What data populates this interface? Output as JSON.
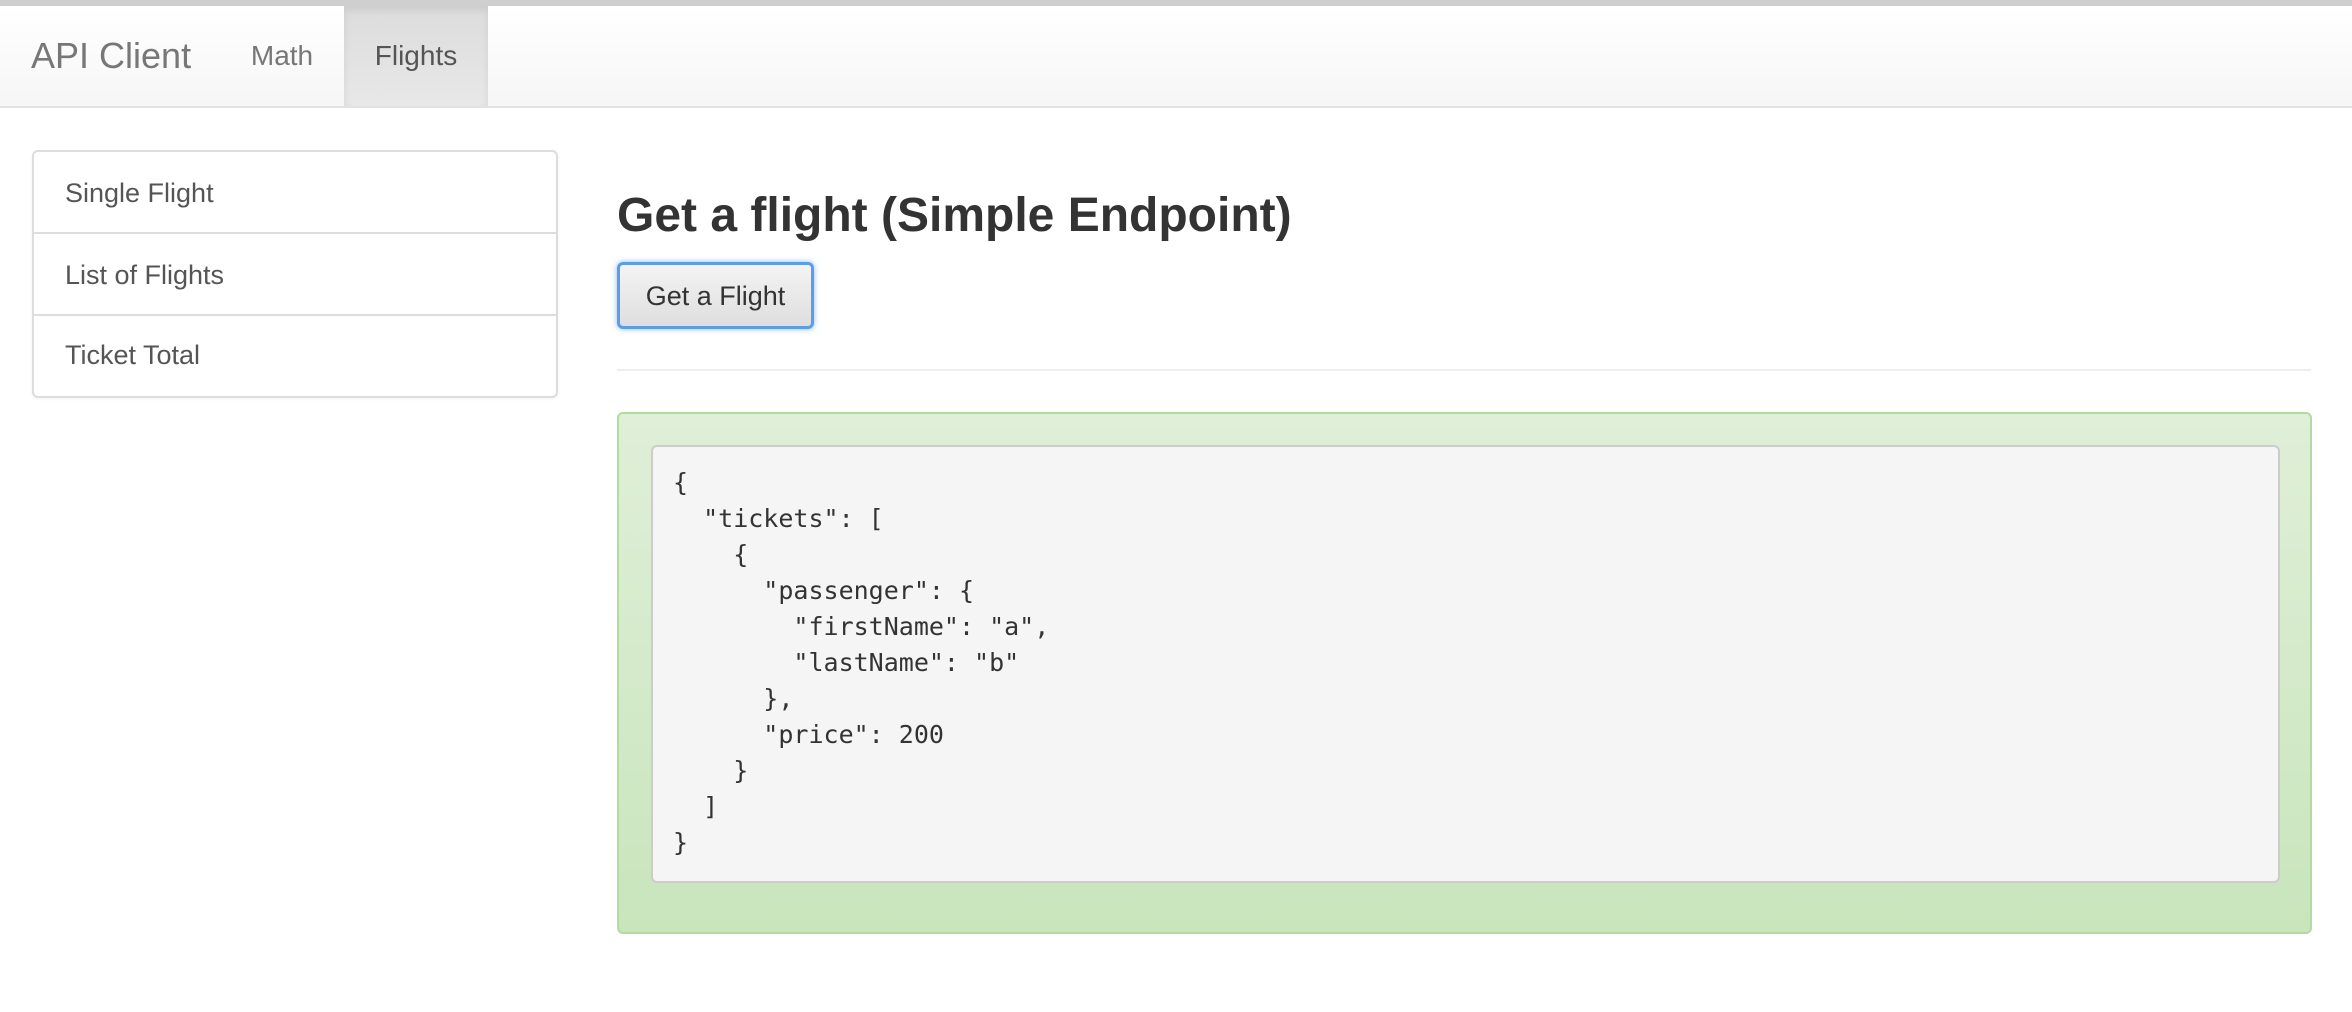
{
  "navbar": {
    "brand": "API Client",
    "items": [
      {
        "label": "Math",
        "active": false
      },
      {
        "label": "Flights",
        "active": true
      }
    ]
  },
  "sidebar": {
    "items": [
      {
        "label": "Single Flight"
      },
      {
        "label": "List of Flights"
      },
      {
        "label": "Ticket Total"
      }
    ]
  },
  "main": {
    "title": "Get a flight (Simple Endpoint)",
    "button_label": "Get a Flight",
    "result_json": "{\n  \"tickets\": [\n    {\n      \"passenger\": {\n        \"firstName\": \"a\",\n        \"lastName\": \"b\"\n      },\n      \"price\": 200\n    }\n  ]\n}"
  },
  "colors": {
    "result_panel": "#d4ebc9",
    "button_focus": "#5a9de8",
    "active_nav": "#dedede"
  }
}
